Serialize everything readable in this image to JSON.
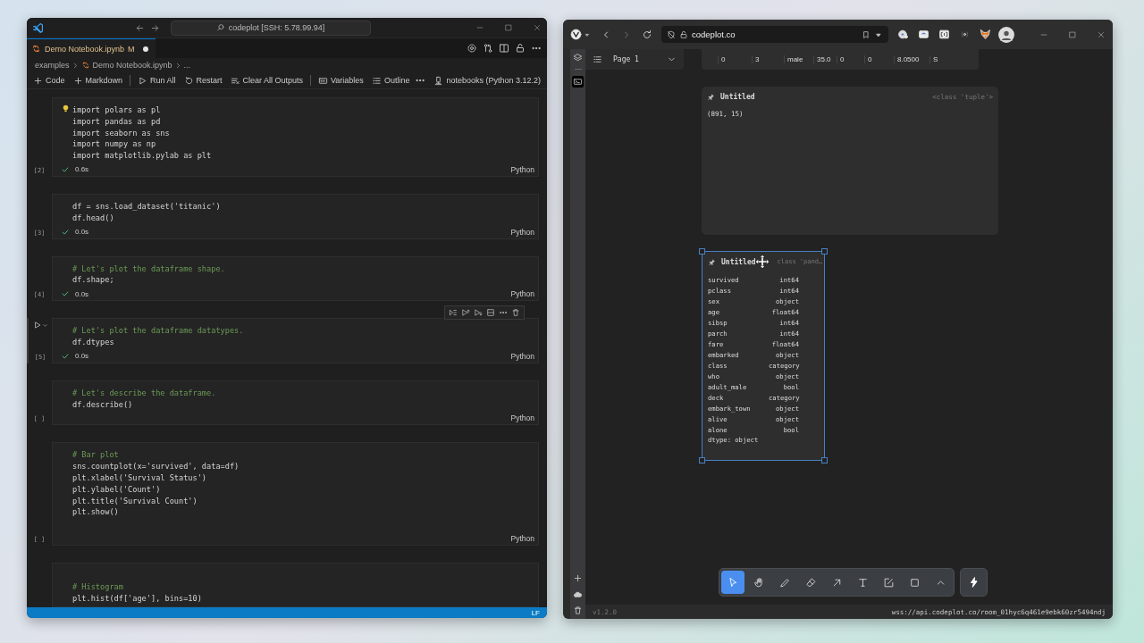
{
  "vscode": {
    "title": "codeplot [SSH: 5.78.99.94]",
    "tab": {
      "label": "Demo Notebook.ipynb",
      "badge": "M",
      "unsaved": true
    },
    "breadcrumb": [
      "examples",
      "Demo Notebook.ipynb",
      "..."
    ],
    "toolbar": [
      {
        "label": "Code",
        "divider_before": false
      },
      {
        "label": "Markdown",
        "divider_before": false
      },
      {
        "label": "Run All",
        "divider_before": true
      },
      {
        "label": "Restart",
        "divider_before": false
      },
      {
        "label": "Clear All Outputs",
        "divider_before": false
      },
      {
        "label": "Variables",
        "divider_before": true
      },
      {
        "label": "Outline",
        "divider_before": false
      }
    ],
    "kernel": "notebooks (Python 3.12.2)",
    "cells": [
      {
        "count": "[2]",
        "focused": false,
        "lightbulb": true,
        "ran": true,
        "time": "0.6s",
        "language": "Python",
        "lines": [
          {
            "kind": "code",
            "text": "import polars as pl"
          },
          {
            "kind": "code",
            "text": "import pandas as pd"
          },
          {
            "kind": "code",
            "text": "import seaborn as sns"
          },
          {
            "kind": "code",
            "text": "import numpy as np"
          },
          {
            "kind": "code",
            "text": "import matplotlib.pylab as plt"
          }
        ]
      },
      {
        "count": "[3]",
        "focused": false,
        "lightbulb": false,
        "ran": true,
        "time": "0.0s",
        "language": "Python",
        "lines": [
          {
            "kind": "code",
            "text": "df = sns.load_dataset('titanic')"
          },
          {
            "kind": "code",
            "text": "df.head()"
          }
        ]
      },
      {
        "count": "[4]",
        "focused": false,
        "lightbulb": false,
        "ran": true,
        "time": "0.0s",
        "language": "Python",
        "lines": [
          {
            "kind": "comment",
            "text": "# Let's plot the dataframe shape."
          },
          {
            "kind": "code",
            "text": "df.shape;"
          }
        ]
      },
      {
        "count": "[5]",
        "focused": true,
        "lightbulb": false,
        "ran": true,
        "time": "0.0s",
        "language": "Python",
        "lines": [
          {
            "kind": "comment",
            "text": "# Let's plot the dataframe datatypes."
          },
          {
            "kind": "code",
            "text": "df.dtypes"
          }
        ]
      },
      {
        "count": "[ ]",
        "focused": false,
        "lightbulb": false,
        "ran": false,
        "language": "Python",
        "lines": [
          {
            "kind": "comment",
            "text": "# Let's describe the dataframe."
          },
          {
            "kind": "code",
            "text": "df.describe()"
          }
        ]
      },
      {
        "count": "[ ]",
        "focused": false,
        "lightbulb": false,
        "ran": false,
        "language": "Python",
        "lines": [
          {
            "kind": "comment",
            "text": "# Bar plot"
          },
          {
            "kind": "code",
            "text": "sns.countplot(x='survived', data=df)"
          },
          {
            "kind": "code",
            "text": "plt.xlabel('Survival Status')"
          },
          {
            "kind": "code",
            "text": "plt.ylabel('Count')"
          },
          {
            "kind": "code",
            "text": "plt.title('Survival Count')"
          },
          {
            "kind": "code",
            "text": "plt.show()"
          }
        ]
      },
      {
        "focused": false,
        "lightbulb": false,
        "lines": [
          {
            "kind": "comment",
            "text": "# Histogram"
          },
          {
            "kind": "code",
            "text": "plt.hist(df['age'], bins=10)"
          }
        ]
      }
    ],
    "status_bar": {
      "line_ending": "LF"
    }
  },
  "browser": {
    "url": "codeplot.co",
    "page": "Page 1",
    "table_row": [
      "0",
      "3",
      "male",
      "35.0",
      "0",
      "0",
      "8.0500",
      "S"
    ],
    "cards": [
      {
        "title": "Untitled",
        "type": "<class 'tuple'>",
        "selected": false,
        "text": "(891, 15)"
      },
      {
        "title": "Untitled",
        "type": "class 'pand…",
        "selected": true,
        "rows": [
          {
            "name": "survived",
            "dtype": "int64"
          },
          {
            "name": "pclass",
            "dtype": "int64"
          },
          {
            "name": "sex",
            "dtype": "object"
          },
          {
            "name": "age",
            "dtype": "float64"
          },
          {
            "name": "sibsp",
            "dtype": "int64"
          },
          {
            "name": "parch",
            "dtype": "int64"
          },
          {
            "name": "fare",
            "dtype": "float64"
          },
          {
            "name": "embarked",
            "dtype": "object"
          },
          {
            "name": "class",
            "dtype": "category"
          },
          {
            "name": "who",
            "dtype": "object"
          },
          {
            "name": "adult_male",
            "dtype": "bool"
          },
          {
            "name": "deck",
            "dtype": "category"
          },
          {
            "name": "embark_town",
            "dtype": "object"
          },
          {
            "name": "alive",
            "dtype": "object"
          },
          {
            "name": "alone",
            "dtype": "bool"
          }
        ],
        "footer": "dtype: object"
      }
    ],
    "tools": [
      {
        "kind": "select",
        "selected": true
      },
      {
        "kind": "hand",
        "selected": false
      },
      {
        "kind": "pencil",
        "selected": false
      },
      {
        "kind": "eraser",
        "selected": false
      },
      {
        "kind": "arrow",
        "selected": false
      },
      {
        "kind": "text",
        "selected": false
      },
      {
        "kind": "note",
        "selected": false
      },
      {
        "kind": "rectangle",
        "selected": false
      },
      {
        "kind": "more",
        "selected": false
      }
    ],
    "version": "v1.2.0",
    "connection": "wss://api.codeplot.co/room_01hyc6q461e9ebk60zr5494ndj"
  }
}
